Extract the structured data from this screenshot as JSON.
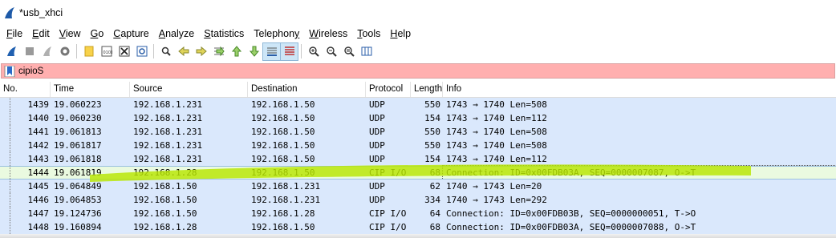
{
  "window": {
    "title": "*usb_xhci"
  },
  "menu": [
    {
      "label": "File",
      "key": "F",
      "rest": "ile"
    },
    {
      "label": "Edit",
      "key": "E",
      "rest": "dit"
    },
    {
      "label": "View",
      "key": "V",
      "rest": "iew"
    },
    {
      "label": "Go",
      "key": "G",
      "rest": "o"
    },
    {
      "label": "Capture",
      "key": "C",
      "rest": "apture"
    },
    {
      "label": "Analyze",
      "key": "A",
      "rest": "nalyze"
    },
    {
      "label": "Statistics",
      "key": "S",
      "rest": "tatistics"
    },
    {
      "label": "Telephony",
      "key": "y",
      "rest": "Telephon"
    },
    {
      "label": "Wireless",
      "key": "W",
      "rest": "ireless"
    },
    {
      "label": "Tools",
      "key": "T",
      "rest": "ools"
    },
    {
      "label": "Help",
      "key": "H",
      "rest": "elp"
    }
  ],
  "toolbar_icons": [
    "start-capture-icon",
    "stop-capture-icon",
    "restart-capture-icon",
    "capture-options-icon",
    "open-file-icon",
    "save-file-icon",
    "close-file-icon",
    "reload-file-icon",
    "find-packet-icon",
    "go-back-icon",
    "go-forward-icon",
    "go-to-packet-icon",
    "go-first-icon",
    "go-last-icon",
    "autoscroll-icon",
    "colorize-icon",
    "zoom-in-icon",
    "zoom-out-icon",
    "zoom-normal-icon",
    "resize-columns-icon"
  ],
  "filter": {
    "value": "cipioS"
  },
  "columns": {
    "no": "No.",
    "time": "Time",
    "source": "Source",
    "destination": "Destination",
    "protocol": "Protocol",
    "length": "Length",
    "info": "Info"
  },
  "packets": [
    {
      "no": "1439",
      "time": "19.060223",
      "source": "192.168.1.231",
      "destination": "192.168.1.50",
      "protocol": "UDP",
      "length": "550",
      "info": "1743 → 1740 Len=508"
    },
    {
      "no": "1440",
      "time": "19.060230",
      "source": "192.168.1.231",
      "destination": "192.168.1.50",
      "protocol": "UDP",
      "length": "154",
      "info": "1743 → 1740 Len=112"
    },
    {
      "no": "1441",
      "time": "19.061813",
      "source": "192.168.1.231",
      "destination": "192.168.1.50",
      "protocol": "UDP",
      "length": "550",
      "info": "1743 → 1740 Len=508"
    },
    {
      "no": "1442",
      "time": "19.061817",
      "source": "192.168.1.231",
      "destination": "192.168.1.50",
      "protocol": "UDP",
      "length": "550",
      "info": "1743 → 1740 Len=508"
    },
    {
      "no": "1443",
      "time": "19.061818",
      "source": "192.168.1.231",
      "destination": "192.168.1.50",
      "protocol": "UDP",
      "length": "154",
      "info": "1743 → 1740 Len=112"
    },
    {
      "no": "1444",
      "time": "19.061819",
      "source": "192.168.1.28",
      "destination": "192.168.1.50",
      "protocol": "CIP I/O",
      "length": "68",
      "info": "Connection: ID=0x00FDB03A, SEQ=0000007087, O->T",
      "selected": true
    },
    {
      "no": "1445",
      "time": "19.064849",
      "source": "192.168.1.50",
      "destination": "192.168.1.231",
      "protocol": "UDP",
      "length": "62",
      "info": "1740 → 1743 Len=20"
    },
    {
      "no": "1446",
      "time": "19.064853",
      "source": "192.168.1.50",
      "destination": "192.168.1.231",
      "protocol": "UDP",
      "length": "334",
      "info": "1740 → 1743 Len=292"
    },
    {
      "no": "1447",
      "time": "19.124736",
      "source": "192.168.1.50",
      "destination": "192.168.1.28",
      "protocol": "CIP I/O",
      "length": "64",
      "info": "Connection: ID=0x00FDB03B, SEQ=0000000051, T->O"
    },
    {
      "no": "1448",
      "time": "19.160894",
      "source": "192.168.1.28",
      "destination": "192.168.1.50",
      "protocol": "CIP I/O",
      "length": "68",
      "info": "Connection: ID=0x00FDB03A, SEQ=0000007088, O->T"
    }
  ],
  "colors": {
    "row_bg": "#dae8fc",
    "filter_bg": "#ffafaf",
    "highlighter": "#b8e600"
  }
}
